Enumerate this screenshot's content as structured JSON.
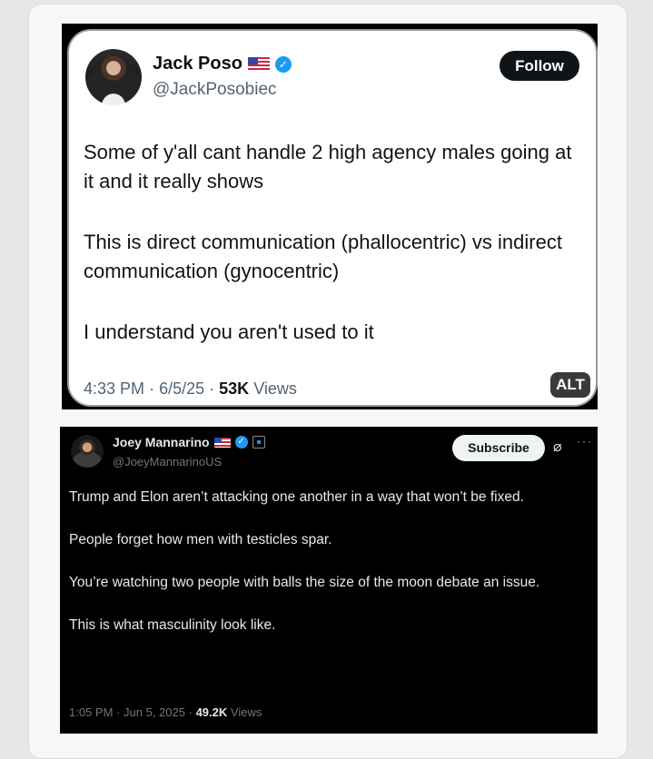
{
  "tweet1": {
    "name": "Jack Poso",
    "handle": "@JackPosobiec",
    "follow_label": "Follow",
    "paragraphs": [
      "Some of y'all cant handle 2 high agency males going at it and it really shows",
      "This is direct communication (phallocentric) vs indirect communication (gynocentric)",
      "I understand you aren't used to it"
    ],
    "time": "4:33 PM",
    "date": "6/5/25",
    "views_count": "53K",
    "views_label": "Views",
    "alt_label": "ALT",
    "badge_glyph": "✓",
    "separator": "·"
  },
  "tweet2": {
    "name": "Joey Mannarino",
    "handle": "@JoeyMannarinoUS",
    "subscribe_label": "Subscribe",
    "paragraphs": [
      "Trump and Elon aren’t attacking one another in a way that won’t be fixed.",
      "People forget how men with testicles spar.",
      "You’re watching two people with balls the size of the moon debate an issue.",
      "This is what masculinity look like."
    ],
    "time": "1:05 PM",
    "date": "Jun 5, 2025",
    "views_count": "49.2K",
    "views_label": "Views",
    "badge_glyph": "✓",
    "separator": "·"
  },
  "icons": {
    "flag": "us-flag-icon",
    "verified": "verified-badge-icon",
    "affiliate": "affiliate-square-icon",
    "grok": "slash-circle-icon",
    "more": "more-dots-icon"
  },
  "colors": {
    "verified_blue": "#1d9bf0",
    "follow_button": "#0f1419",
    "muted_text": "#536471"
  }
}
